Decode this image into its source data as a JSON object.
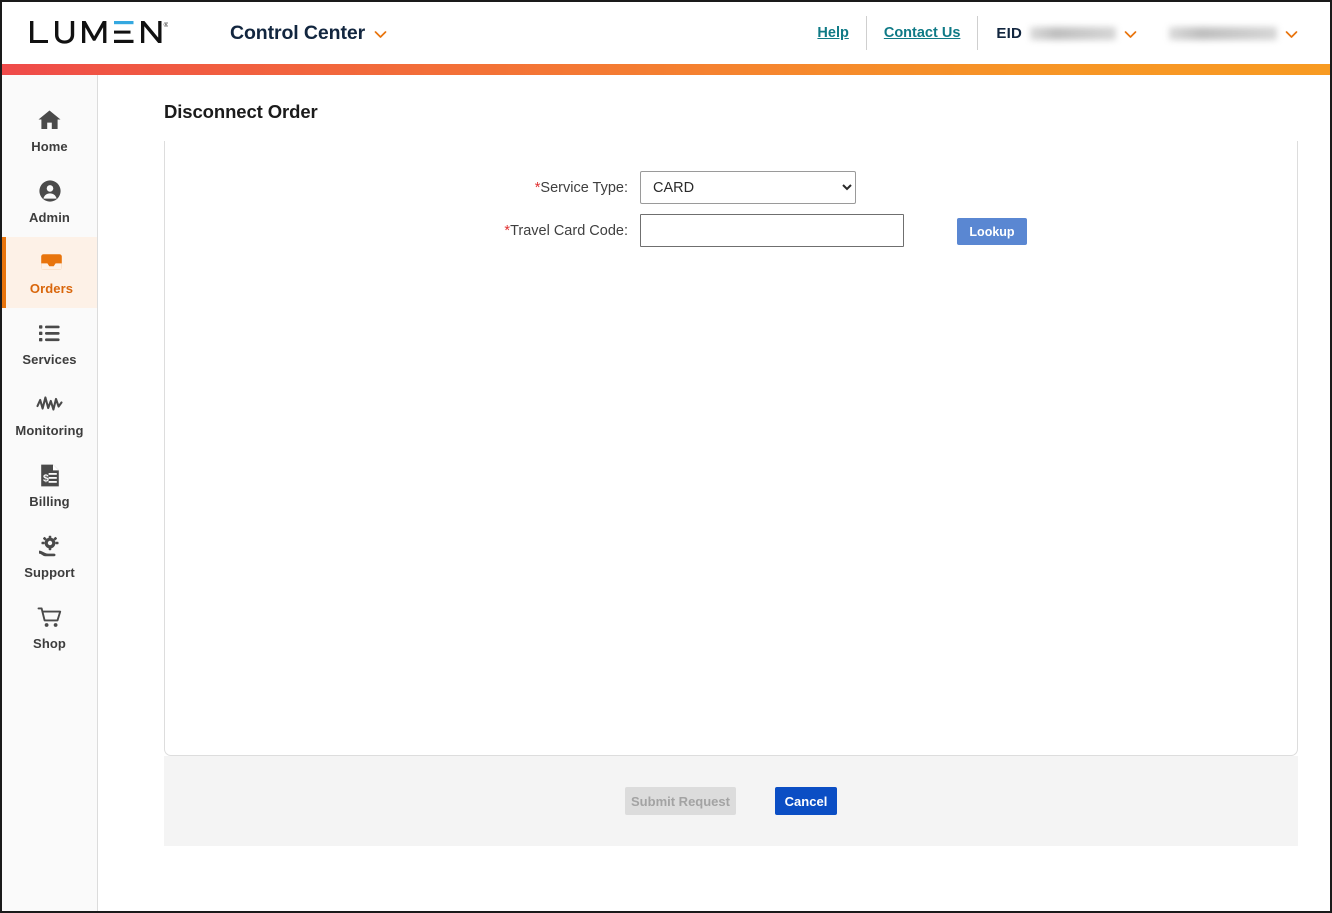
{
  "header": {
    "logo_text": "LUMEN",
    "logo_registered": "®",
    "app_title": "Control Center",
    "app_title_chevron_icon": "chevron-down-icon",
    "help_label": "Help",
    "contact_label": "Contact Us",
    "eid_label": "EID",
    "eid_value": "",
    "account_value": "",
    "eid_chevron_icon": "chevron-down-icon",
    "account_chevron_icon": "chevron-down-icon"
  },
  "sidebar": {
    "items": [
      {
        "label": "Home",
        "icon": "home-icon",
        "active": false
      },
      {
        "label": "Admin",
        "icon": "user-circle-icon",
        "active": false
      },
      {
        "label": "Orders",
        "icon": "inbox-tray-icon",
        "active": true
      },
      {
        "label": "Services",
        "icon": "list-icon",
        "active": false
      },
      {
        "label": "Monitoring",
        "icon": "activity-pulse-icon",
        "active": false
      },
      {
        "label": "Billing",
        "icon": "invoice-icon",
        "active": false
      },
      {
        "label": "Support",
        "icon": "gear-hand-icon",
        "active": false
      },
      {
        "label": "Shop",
        "icon": "shopping-cart-icon",
        "active": false
      }
    ]
  },
  "main": {
    "page_title": "Disconnect Order",
    "form": {
      "service_type": {
        "label": "Service Type:",
        "required_marker": "*",
        "value": "CARD",
        "options": [
          "CARD"
        ]
      },
      "travel_card_code": {
        "label": "Travel Card Code:",
        "required_marker": "*",
        "value": "",
        "placeholder": ""
      },
      "lookup_button": "Lookup"
    },
    "actions": {
      "submit_label": "Submit Request",
      "submit_disabled": true,
      "cancel_label": "Cancel"
    }
  },
  "colors": {
    "brand_orange": "#e8740c",
    "accent_gradient_start": "#ef4a4a",
    "accent_gradient_end": "#f89b22",
    "link_teal": "#0f7a86",
    "cancel_blue": "#0b4ec4",
    "lookup_blue": "#5a87d2",
    "required_red": "#e03131",
    "active_nav_bg": "#fdf1e7"
  }
}
